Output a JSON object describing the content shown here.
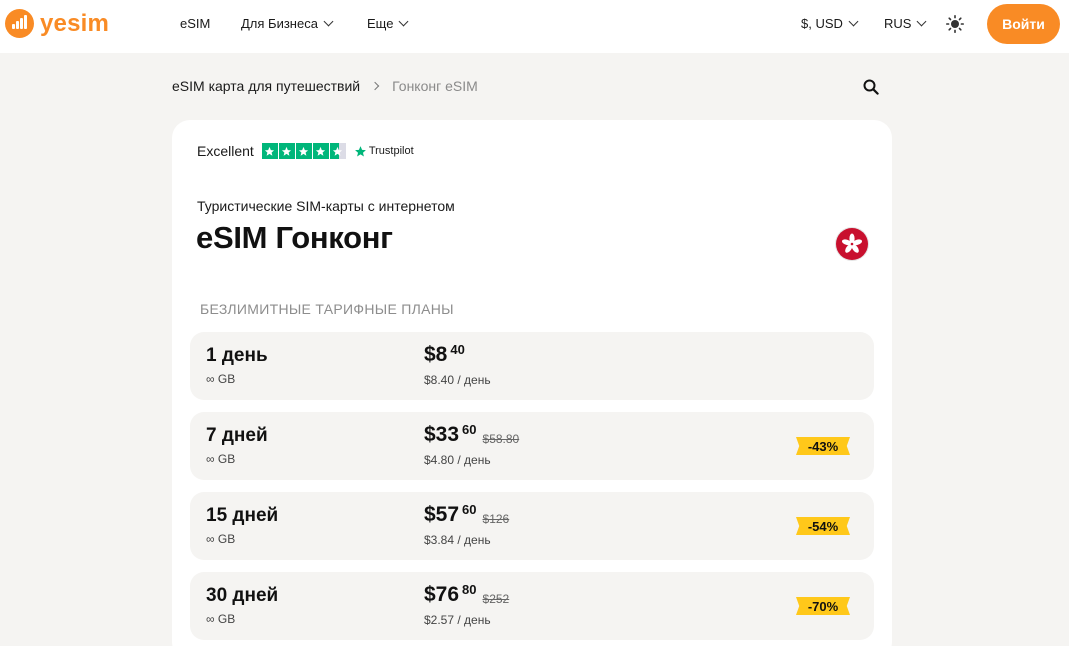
{
  "header": {
    "logo_text": "yesim",
    "nav": [
      {
        "label": "eSIM",
        "dropdown": false
      },
      {
        "label": "Для Бизнеса",
        "dropdown": true
      },
      {
        "label": "Еще",
        "dropdown": true
      }
    ],
    "currency": "$, USD",
    "language": "RUS",
    "login_label": "Войти",
    "accent_color": "#f98b25"
  },
  "breadcrumb": {
    "parent": "eSIM карта для путешествий",
    "current": "Гонконг eSIM"
  },
  "trustpilot": {
    "rating_label": "Excellent",
    "stars": 4.5,
    "brand": "Trustpilot",
    "color": "#00b67a"
  },
  "hero": {
    "subtitle": "Туристические SIM-карты с интернетом",
    "title": "eSIM Гонконг",
    "flag_icon": "hong-kong-flag-icon"
  },
  "section_label": "БЕЗЛИМИТНЫЕ ТАРИФНЫЕ ПЛАНЫ",
  "plans": [
    {
      "days": "1 день",
      "data": "∞ GB",
      "price": "$8",
      "cents": "40",
      "old_price": "",
      "per_day": "$8.40 / день",
      "discount": ""
    },
    {
      "days": "7 дней",
      "data": "∞ GB",
      "price": "$33",
      "cents": "60",
      "old_price": "$58.80",
      "per_day": "$4.80 / день",
      "discount": "-43%"
    },
    {
      "days": "15 дней",
      "data": "∞ GB",
      "price": "$57",
      "cents": "60",
      "old_price": "$126",
      "per_day": "$3.84 / день",
      "discount": "-54%"
    },
    {
      "days": "30 дней",
      "data": "∞ GB",
      "price": "$76",
      "cents": "80",
      "old_price": "$252",
      "per_day": "$2.57 / день",
      "discount": "-70%"
    }
  ]
}
